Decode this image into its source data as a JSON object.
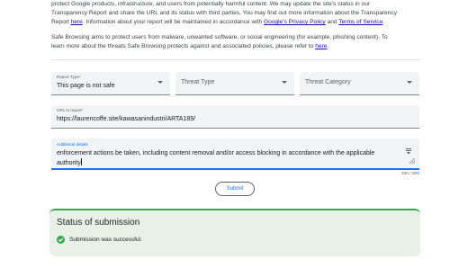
{
  "intro": {
    "line1": "protect Google products, infrastructure, and users from potentially harmful content. We may update the site's status in our",
    "line2": "Transparency Report and share the URL and its status with third parties. You may find out more information about the Transparency",
    "line3_pre": "Report ",
    "line3_link1": "here",
    "line3_mid": ". Information about your report will be maintained in accordance with ",
    "line3_link2": "Google's Privacy Policy",
    "line3_and": " and ",
    "line3_link3": "Terms of Service",
    "line3_end": "."
  },
  "safe_browsing": {
    "line1": "Safe Browsing aims to protect users from malware, unwanted software, or social engineering (for example, phishing content). To",
    "line2_pre": "learn more about the threats Safe Browsing protects against and associated policies, please refer to ",
    "line2_link": "here",
    "line2_end": "."
  },
  "form": {
    "report_type": {
      "label": "Report Type*",
      "value": "This page is not safe"
    },
    "threat_type": {
      "placeholder": "Threat Type"
    },
    "threat_category": {
      "placeholder": "Threat Category"
    },
    "url": {
      "label": "URL to report*",
      "value": "https://laurencoffe.site/kawasanindustri/ARTA189/"
    },
    "details": {
      "label": "Additional details",
      "value": "enforcement actions be taken, including content removal and/or access blocking in accordance with the applicable authority",
      "counter": "480 / 800"
    },
    "submit_label": "Submit"
  },
  "status": {
    "title": "Status of submission",
    "message": "Submission was successful."
  },
  "colors": {
    "accent": "#1a73e8",
    "success": "#34a853",
    "link": "#1a0dab"
  }
}
